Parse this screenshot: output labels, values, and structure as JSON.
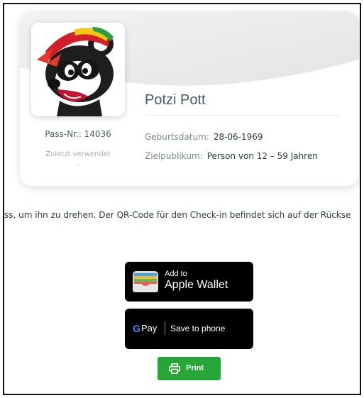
{
  "pass": {
    "name": "Potzi Pott",
    "pass_number_label": "Pass-Nr.: 14036",
    "last_used_label": "Zuletzt verwendet",
    "last_used_value": "-",
    "birthdate_label": "Geburtsdatum:",
    "birthdate_value": "28-06-1969",
    "audience_label": "Zielpublikum:",
    "audience_value": "Person von 12 – 59 Jahren",
    "photo_icon": "raccoon-mascot"
  },
  "instruction_text": "ss, um ihn zu drehen. Der QR-Code für den Check-in befindet sich auf der Rückse",
  "buttons": {
    "apple_wallet_small": "Add to",
    "apple_wallet_big": "Apple Wallet",
    "google_pay_g": "G",
    "google_pay_pay": "Pay",
    "google_pay_action": "Save to phone",
    "print_label": "Print",
    "print_color": "#25a637"
  }
}
